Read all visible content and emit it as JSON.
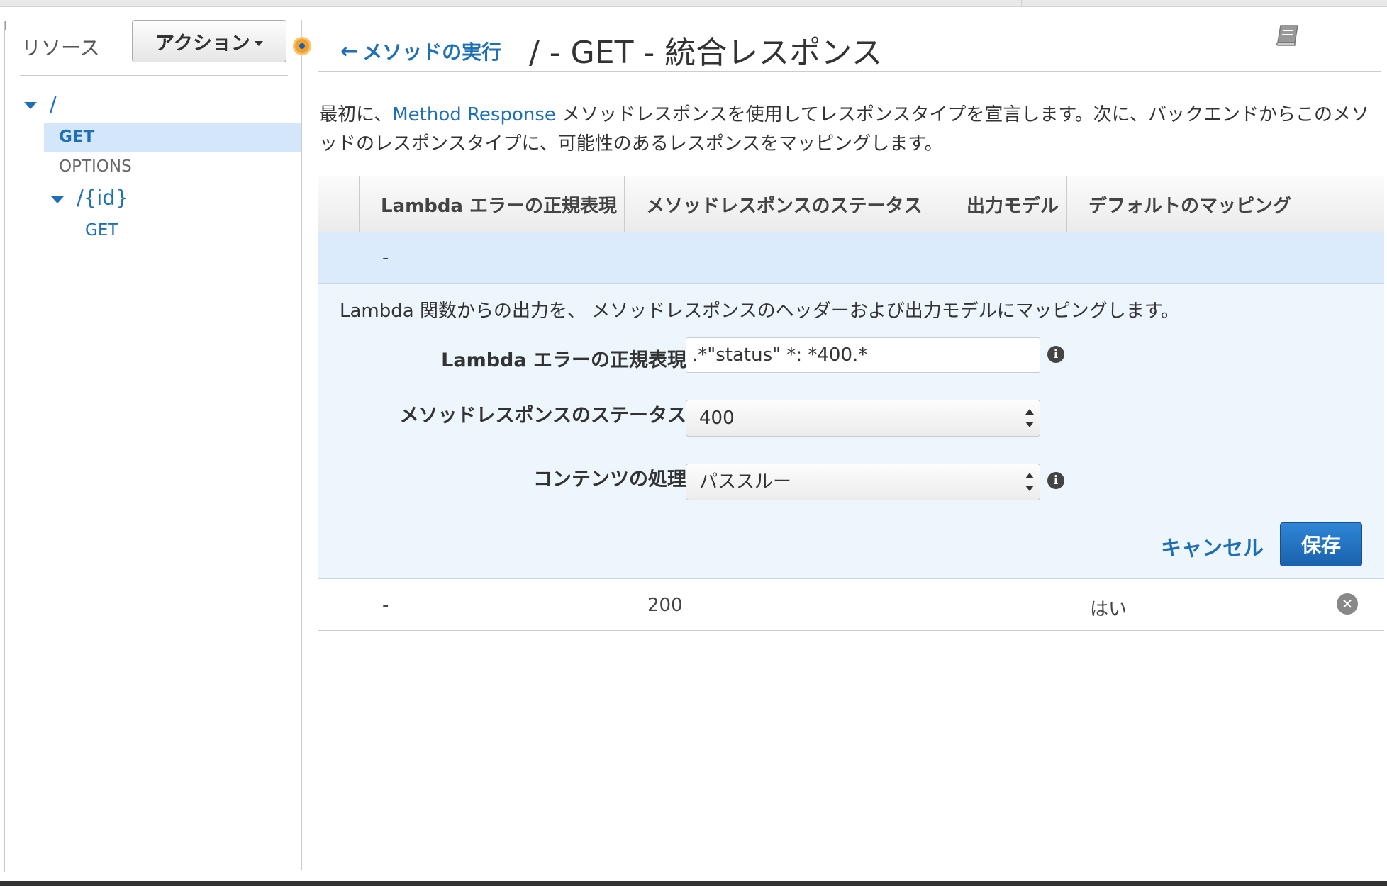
{
  "sidebar": {
    "resources_label": "リソース",
    "actions_button": "アクション",
    "tree": {
      "root": "/",
      "root_methods": [
        "GET",
        "OPTIONS"
      ],
      "child": "/{id}",
      "child_methods": [
        "GET"
      ]
    }
  },
  "header": {
    "back_link": "メソッドの実行",
    "title": "/ - GET - 統合レスポンス"
  },
  "description": {
    "prefix": "最初に、",
    "link": "Method Response",
    "suffix": " メソッドレスポンスを使用してレスポンスタイプを宣言します。次に、バックエンドからこのメソッドのレスポンスタイプに、可能性のあるレスポンスをマッピングします。"
  },
  "table": {
    "headers": [
      "Lambda エラーの正規表現",
      "メソッドレスポンスのステータス",
      "出力モデル",
      "デフォルトのマッピング"
    ],
    "selected_row": {
      "regex": "-"
    },
    "rows": [
      {
        "regex": "-",
        "status": "200",
        "model": "",
        "default": "はい"
      }
    ]
  },
  "edit": {
    "description": "Lambda 関数からの出力を、 メソッドレスポンスのヘッダーおよび出力モデルにマッピングします。",
    "regex_label": "Lambda エラーの正規表現",
    "regex_value": ".*\"status\" *: *400.*",
    "status_label": "メソッドレスポンスのステータス",
    "status_value": "400",
    "content_label": "コンテンツの処理",
    "content_value": "パススルー",
    "cancel_label": "キャンセル",
    "save_label": "保存"
  },
  "colors": {
    "link": "#1f6fb5",
    "selected_bg": "#dbebfb",
    "panel_bg": "#eef6fd",
    "save_button": "#1a62ad"
  }
}
